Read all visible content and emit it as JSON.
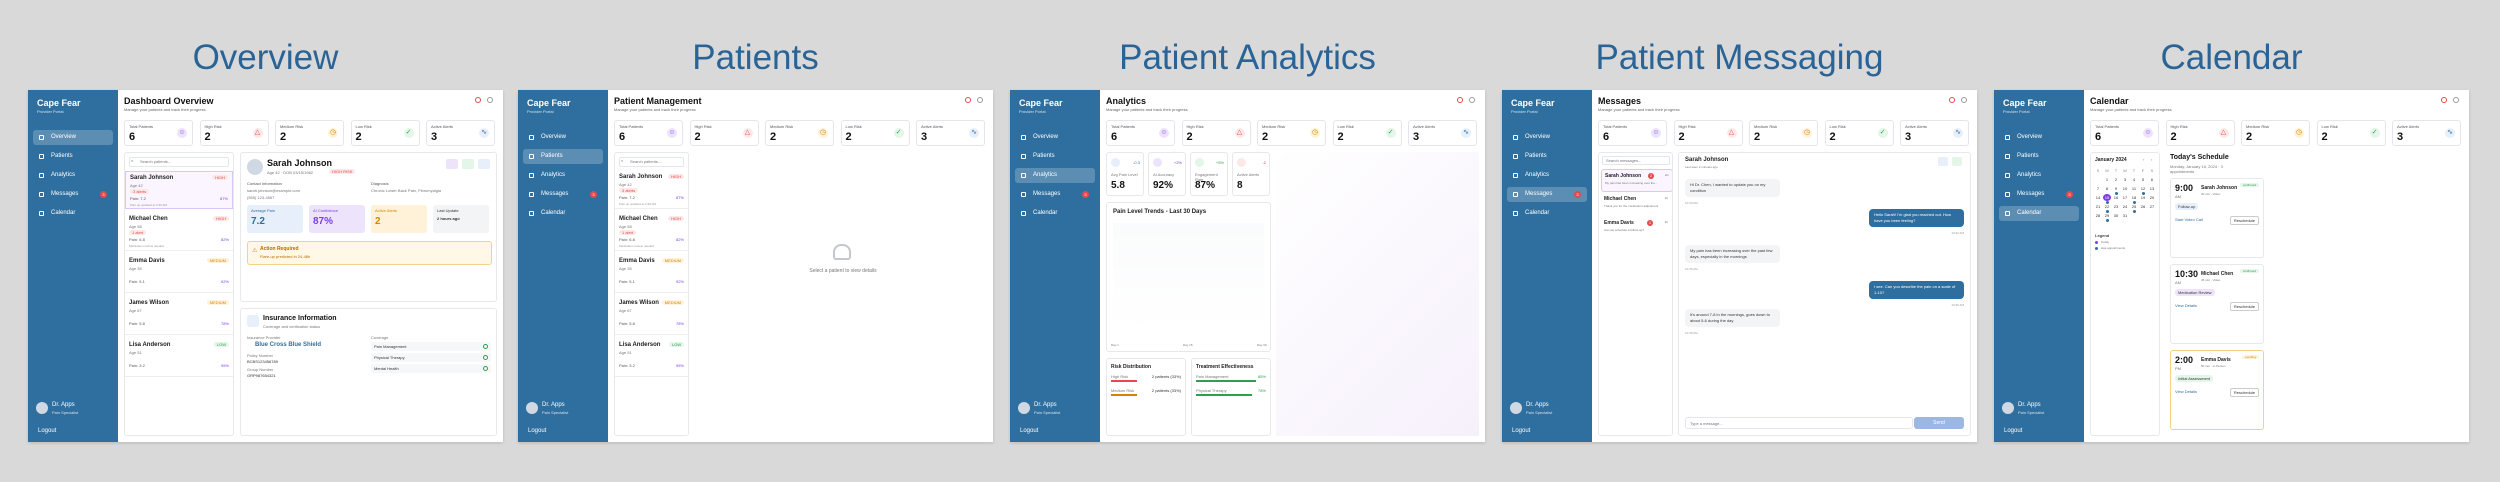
{
  "sections": [
    "Overview",
    "Patients",
    "Patient Analytics",
    "Patient Messaging",
    "Calendar"
  ],
  "app": {
    "brand": "Cape Fear",
    "brand_sub": "Provider Portal",
    "nav": [
      "Overview",
      "Patients",
      "Analytics",
      "Messages",
      "Calendar"
    ],
    "messages_badge": "3",
    "user_name": "Dr. Apps",
    "user_role": "Pain Specialist",
    "logout": "Logout"
  },
  "page_sub": "Manage your patients and track their progress",
  "stats": {
    "labels": [
      "Total Patients",
      "High Risk",
      "Medium Risk",
      "Low Risk",
      "Active Alerts"
    ],
    "values": [
      "6",
      "2",
      "2",
      "2",
      "3"
    ]
  },
  "colors": {
    "sidebar": "#2f6f9f",
    "accent": "#7b3fe4",
    "high": "#e5484d",
    "medium": "#d68400",
    "low": "#2e9e4f",
    "heading": "#2a6496"
  },
  "overview": {
    "title": "Dashboard Overview",
    "search_placeholder": "Search patients...",
    "patients": [
      {
        "name": "Sarah Johnson",
        "age": "Age 42",
        "alert": "3 alerts",
        "pain": "Pain: 7.2",
        "adherence": "87%",
        "risk": "HIGH",
        "updated": "Pain up updated at 2:30 AM"
      },
      {
        "name": "Michael Chen",
        "age": "Age 58",
        "alert": "1 alert",
        "pain": "Pain: 6.8",
        "adherence": "82%",
        "risk": "HIGH",
        "updated": "Medication review needed"
      },
      {
        "name": "Emma Davis",
        "age": "Age 35",
        "alert": "",
        "pain": "Pain: 5.1",
        "adherence": "92%",
        "risk": "MEDIUM",
        "updated": ""
      },
      {
        "name": "James Wilson",
        "age": "Age 67",
        "alert": "",
        "pain": "Pain: 5.8",
        "adherence": "78%",
        "risk": "MEDIUM",
        "updated": ""
      },
      {
        "name": "Lisa Anderson",
        "age": "Age 51",
        "alert": "",
        "pain": "Pain: 3.2",
        "adherence": "95%",
        "risk": "LOW",
        "updated": ""
      }
    ],
    "detail": {
      "name": "Sarah Johnson",
      "meta": "Age 42 · DOB 03/15/1982",
      "risk": "HIGH RISK",
      "contact_label": "Contact Information",
      "email": "sarah.johnson@example.com",
      "phone": "(555) 123-4567",
      "diagnosis_label": "Diagnosis",
      "diagnosis": "Chronic Lower Back Pain, Fibromyalgia",
      "metrics": [
        {
          "label": "Average Pain",
          "value": "7.2"
        },
        {
          "label": "AI Confidence",
          "value": "87%"
        },
        {
          "label": "Active Alerts",
          "value": "2"
        },
        {
          "label": "Last Update",
          "value": "2 hours ago"
        }
      ],
      "action_title": "Action Required",
      "action_text": "Flare-up predicted in 24-48h",
      "insurance_title": "Insurance Information",
      "insurance_sub": "Coverage and verification status",
      "provider_label": "Insurance Provider",
      "provider": "Blue Cross Blue Shield",
      "policy_label": "Policy Number",
      "policy": "BCBS123456789",
      "group_label": "Group Number",
      "group": "GRP987654321",
      "coverage_label": "Coverage",
      "coverage": [
        "Pain Management",
        "Physical Therapy",
        "Mental Health"
      ]
    }
  },
  "patients_page": {
    "title": "Patient Management",
    "empty": "Select a patient to view details"
  },
  "analytics": {
    "title": "Analytics",
    "kpis": [
      {
        "label": "Avg Pain Level",
        "value": "5.8",
        "trend": "-0.3"
      },
      {
        "label": "AI Accuracy",
        "value": "92%",
        "trend": "+2%"
      },
      {
        "label": "Engagement Rate",
        "value": "87%",
        "trend": "+5%"
      },
      {
        "label": "Active Alerts",
        "value": "8",
        "trend": "-2"
      }
    ],
    "trend_title": "Pain Level Trends - Last 30 Days",
    "trend_x": [
      "Day 1",
      "Day 15",
      "Day 30"
    ],
    "risk_title": "Risk Distribution",
    "risk_rows": [
      {
        "label": "High Risk",
        "value": "2 patients (33%)"
      },
      {
        "label": "Medium Risk",
        "value": "2 patients (33%)"
      }
    ],
    "treat_title": "Treatment Effectiveness",
    "treat_rows": [
      {
        "label": "Pain Management",
        "value": "85%"
      },
      {
        "label": "Physical Therapy",
        "value": "78%"
      }
    ]
  },
  "messaging": {
    "title": "Messages",
    "search_placeholder": "Search messages...",
    "threads": [
      {
        "name": "Sarah Johnson",
        "preview": "My pain has been increasing over the...",
        "time": "2m",
        "badge": "2"
      },
      {
        "name": "Michael Chen",
        "preview": "Thank you for the medication adjustment",
        "time": "1h",
        "badge": ""
      },
      {
        "name": "Emma Davis",
        "preview": "Can we schedule a follow-up?",
        "time": "3h",
        "badge": "1"
      }
    ],
    "chat_name": "Sarah Johnson",
    "chat_status": "Last seen 2 minutes ago",
    "messages": [
      {
        "dir": "in",
        "text": "Hi Dr. Chen, I wanted to update you on my condition",
        "time": "10:30 AM"
      },
      {
        "dir": "out",
        "text": "Hello Sarah! I'm glad you reached out. How have you been feeling?",
        "time": "10:32 AM"
      },
      {
        "dir": "in",
        "text": "My pain has been increasing over the past few days, especially in the mornings",
        "time": "10:35 AM"
      },
      {
        "dir": "out",
        "text": "I see. Can you describe the pain on a scale of 1-10?",
        "time": "10:36 AM"
      },
      {
        "dir": "in",
        "text": "It's around 7-8 in the mornings, goes down to about 5-6 during the day",
        "time": "10:38 AM"
      }
    ],
    "input_placeholder": "Type a message...",
    "send": "Send"
  },
  "calendar": {
    "title": "Calendar",
    "month": "January 2024",
    "weekdays": [
      "S",
      "M",
      "T",
      "W",
      "T",
      "F",
      "S"
    ],
    "legend_title": "Legend",
    "legend": [
      "Today",
      "Has appointments"
    ],
    "schedule_title": "Today's Schedule",
    "schedule_date": "Monday, January 15, 2024 · 3 appointments",
    "appointments": [
      {
        "time": "9:00",
        "ampm": "AM",
        "name": "Sarah Johnson",
        "meta": "30 min · Video",
        "status": "confirmed",
        "type": "Follow-up",
        "action": "Start Video Call",
        "button": "Reschedule"
      },
      {
        "time": "10:30",
        "ampm": "AM",
        "name": "Michael Chen",
        "meta": "45 min · Video",
        "status": "confirmed",
        "type": "Medication Review",
        "action": "View Details",
        "button": "Reschedule"
      },
      {
        "time": "2:00",
        "ampm": "PM",
        "name": "Emma Davis",
        "meta": "60 min · In-Person",
        "status": "pending",
        "type": "Initial Assessment",
        "action": "View Details",
        "button": "Reschedule"
      }
    ]
  }
}
